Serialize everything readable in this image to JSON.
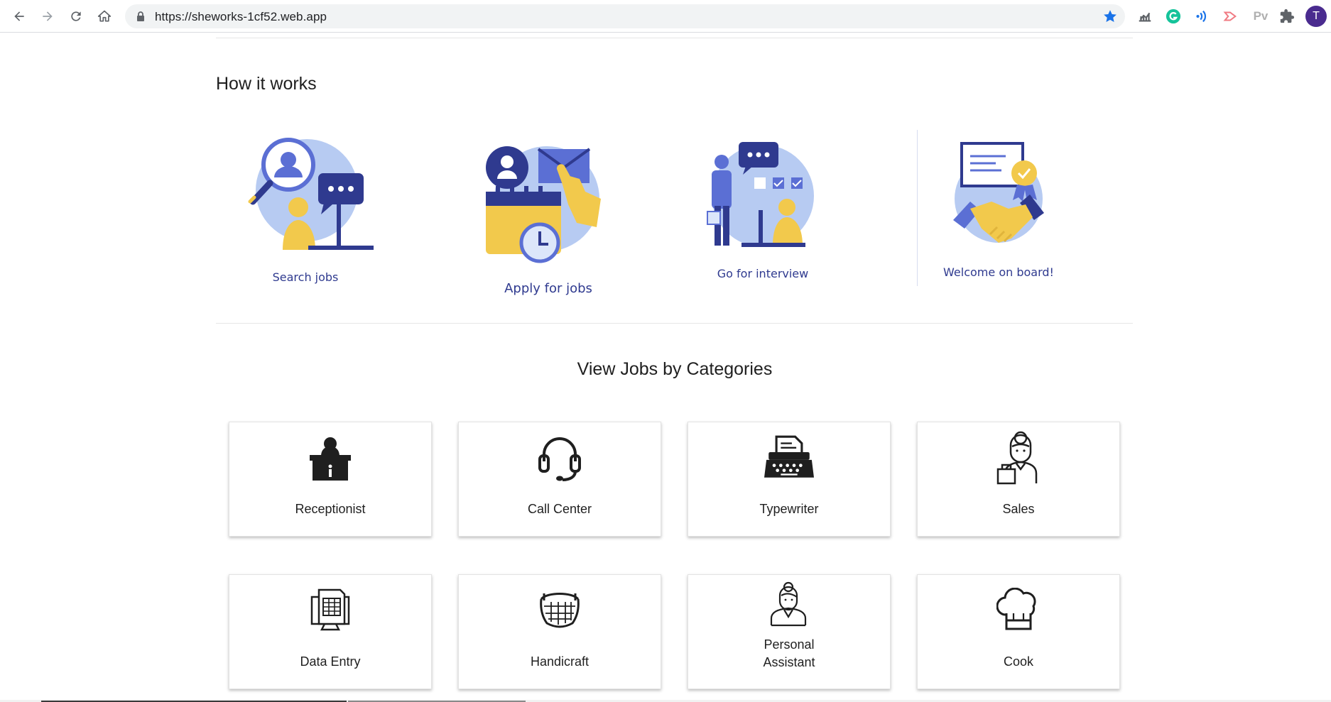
{
  "browser": {
    "url": "https://sheworks-1cf52.web.app",
    "avatar_letter": "T",
    "icons": [
      "back-arrow-icon",
      "forward-arrow-icon",
      "reload-icon",
      "home-icon",
      "lock-icon",
      "bookmark-star-icon",
      "analytics-extension-icon",
      "grammarly-extension-icon",
      "read-aloud-extension-icon",
      "share-extension-icon",
      "pv-extension-icon",
      "puzzle-extensions-icon"
    ],
    "pv_label": "Pv"
  },
  "how_it_works": {
    "title": "How it works",
    "steps": [
      {
        "label": "Search jobs",
        "icon": "search-jobs-illustration"
      },
      {
        "label": "Apply for jobs",
        "icon": "apply-jobs-illustration"
      },
      {
        "label": "Go for interview",
        "icon": "interview-illustration"
      },
      {
        "label": "Welcome on board!",
        "icon": "handshake-illustration"
      }
    ]
  },
  "categories": {
    "title": "View Jobs by Categories",
    "items": [
      {
        "label": "Receptionist",
        "icon": "receptionist-icon"
      },
      {
        "label": "Call Center",
        "icon": "headset-icon"
      },
      {
        "label": "Typewriter",
        "icon": "typewriter-icon"
      },
      {
        "label": "Sales",
        "icon": "sales-person-icon"
      },
      {
        "label": "Data Entry",
        "icon": "data-entry-icon"
      },
      {
        "label": "Handicraft",
        "icon": "basket-icon"
      },
      {
        "label": "Personal Assistant",
        "label_line1": "Personal",
        "label_line2": "Assistant",
        "icon": "assistant-icon"
      },
      {
        "label": "Cook",
        "icon": "chef-hat-icon"
      }
    ]
  },
  "colors": {
    "illustration_navy": "#2f3a8f",
    "illustration_blue": "#5b6fd4",
    "illustration_lightblue": "#b7cbf2",
    "illustration_yellow": "#f2c94c",
    "bookmark_blue": "#1a73e8"
  }
}
